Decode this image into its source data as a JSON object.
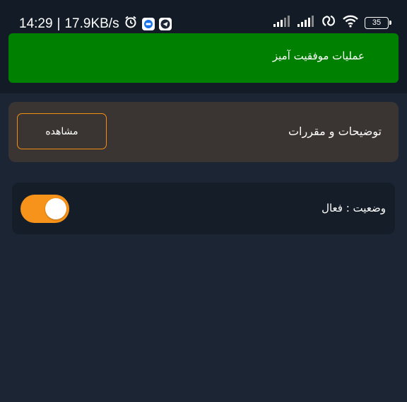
{
  "status_bar": {
    "time": "14:29",
    "separator": "|",
    "net_speed": "17.9KB/s",
    "battery": "35",
    "icons": [
      "alarm-icon",
      "messages-app-icon",
      "telegram-icon",
      "signal-icon",
      "signal-icon",
      "hotspot-icon",
      "wifi-icon",
      "battery-icon"
    ]
  },
  "toast": {
    "message": "عملیات موفقیت آمیز",
    "color": "#008000"
  },
  "terms": {
    "title": "توضیحات و مقررات",
    "view_label": "مشاهده",
    "accent": "#f28f12"
  },
  "status_card": {
    "label": "وضعیت : فعال",
    "toggle_on": true,
    "accent": "#f7931a"
  }
}
